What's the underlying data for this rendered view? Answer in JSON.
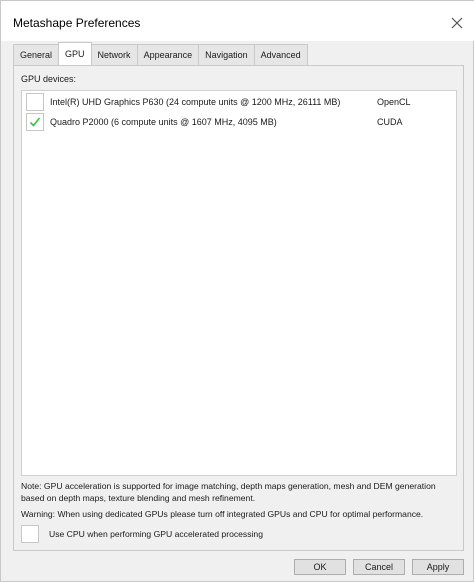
{
  "window": {
    "title": "Metashape Preferences"
  },
  "tabs": [
    {
      "label": "General",
      "active": false
    },
    {
      "label": "GPU",
      "active": true
    },
    {
      "label": "Network",
      "active": false
    },
    {
      "label": "Appearance",
      "active": false
    },
    {
      "label": "Navigation",
      "active": false
    },
    {
      "label": "Advanced",
      "active": false
    }
  ],
  "gpu": {
    "devices_label": "GPU devices:",
    "devices": [
      {
        "name": "Intel(R) UHD Graphics P630 (24 compute units @ 1200 MHz, 26111 MB)",
        "api": "OpenCL",
        "checked": false
      },
      {
        "name": "Quadro P2000 (6 compute units @ 1607 MHz, 4095 MB)",
        "api": "CUDA",
        "checked": true
      }
    ],
    "note": "Note: GPU acceleration is supported for image matching, depth maps generation, mesh and DEM generation based on depth maps, texture blending and mesh refinement.",
    "warning": "Warning: When using dedicated GPUs please turn off integrated GPUs and CPU for optimal performance.",
    "use_cpu_label": "Use CPU when performing GPU accelerated processing",
    "use_cpu_checked": false
  },
  "buttons": {
    "ok": "OK",
    "cancel": "Cancel",
    "apply": "Apply"
  },
  "colors": {
    "checkmark": "#3cc24a",
    "window_bg": "#f0f0f0",
    "list_bg": "#ffffff"
  },
  "icons": {
    "close": "close-icon",
    "check": "checkmark-icon"
  }
}
